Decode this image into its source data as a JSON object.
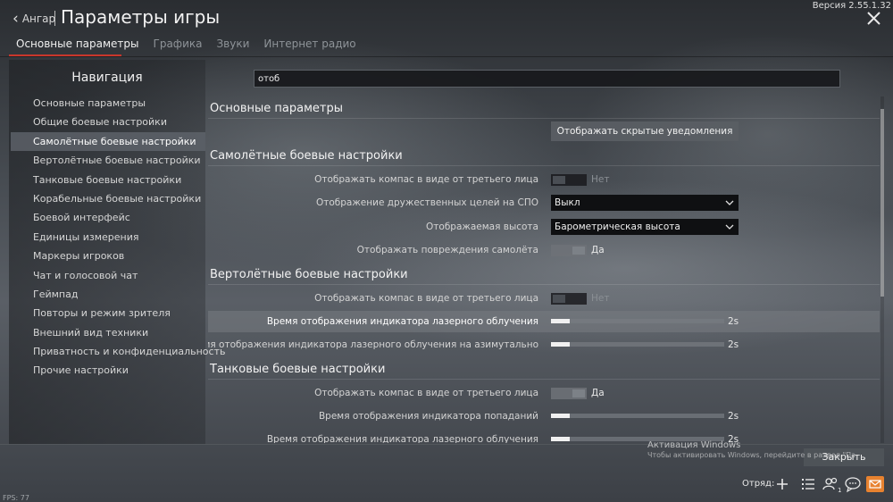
{
  "header": {
    "back_label": "Ангар",
    "title": "Параметры игры",
    "version": "Версия 2.55.1.32"
  },
  "tabs": [
    {
      "label": "Основные параметры",
      "active": true
    },
    {
      "label": "Графика",
      "active": false
    },
    {
      "label": "Звуки",
      "active": false
    },
    {
      "label": "Интернет радио",
      "active": false
    }
  ],
  "nav": {
    "title": "Навигация",
    "items": [
      {
        "label": "Основные параметры"
      },
      {
        "label": "Общие боевые настройки"
      },
      {
        "label": "Самолётные боевые настройки",
        "active": true
      },
      {
        "label": "Вертолётные боевые настройки"
      },
      {
        "label": "Танковые боевые настройки"
      },
      {
        "label": "Корабельные боевые настройки"
      },
      {
        "label": "Боевой интерфейс"
      },
      {
        "label": "Единицы измерения"
      },
      {
        "label": "Маркеры игроков"
      },
      {
        "label": "Чат и голосовой чат"
      },
      {
        "label": "Геймпад"
      },
      {
        "label": "Повторы и режим зрителя"
      },
      {
        "label": "Внешний вид техники"
      },
      {
        "label": "Приватность и конфиденциальность"
      },
      {
        "label": "Прочие настройки"
      }
    ]
  },
  "search": {
    "value": "отоб"
  },
  "settings": {
    "main": {
      "title": "Основные параметры",
      "show_hidden_button": "Отображать скрытые уведомления"
    },
    "aircraft": {
      "title": "Самолётные боевые настройки",
      "compass_label": "Отображать компас в виде от третьего лица",
      "compass_state": "Нет",
      "friendly_label": "Отображение дружественных целей на СПО",
      "friendly_value": "Выкл",
      "altitude_label": "Отображаемая высота",
      "altitude_value": "Барометрическая высота",
      "damage_label": "Отображать повреждения самолёта",
      "damage_state": "Да"
    },
    "helicopter": {
      "title": "Вертолётные боевые настройки",
      "compass_label": "Отображать компас в виде от третьего лица",
      "compass_state": "Нет",
      "laser_label": "Время отображения индикатора лазерного облучения",
      "laser_value": "2s",
      "laser_fraction": 0.11,
      "laser_az_label": "Время отображения индикатора лазерного облучения на азимутально",
      "laser_az_value": "2s",
      "laser_az_fraction": 0.11
    },
    "tank": {
      "title": "Танковые боевые настройки",
      "compass_label": "Отображать компас в виде от третьего лица",
      "compass_state": "Да",
      "hit_label": "Время отображения индикатора попаданий",
      "hit_value": "2s",
      "hit_fraction": 0.11,
      "laser_label": "Время отображения индикатора лазерного облучения",
      "laser_value": "2s",
      "laser_fraction": 0.11
    }
  },
  "footer": {
    "close_label": "Закрыть",
    "activation_title": "Активация Windows",
    "activation_text": "Чтобы активировать Windows, перейдите в раздел \"Па",
    "squad_label": "Отряд:",
    "friends_badge": "1",
    "fps": "FPS: 77"
  },
  "colors": {
    "accent": "#c9372c",
    "mail": "#e8822f"
  }
}
